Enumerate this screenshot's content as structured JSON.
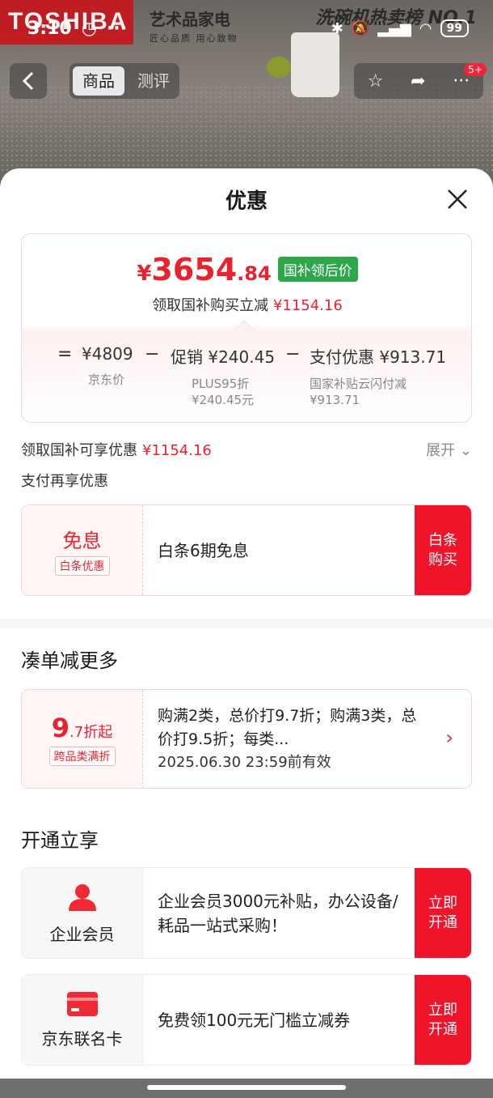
{
  "status_bar": {
    "time": "3:10",
    "battery": "99"
  },
  "banner": {
    "brand": "TOSHIBA",
    "slogan": "艺术品家电",
    "slogan_sub": "匠心品质 用心致物",
    "rank": "洗碗机热卖榜 NO.1"
  },
  "nav": {
    "back_icon": "chevron-left-icon",
    "tabs": [
      "商品",
      "测评"
    ],
    "badge": "5+"
  },
  "sheet": {
    "title": "优惠",
    "close_icon": "close-icon"
  },
  "price_card": {
    "yen": "¥",
    "price_int": "3654",
    "price_dec": ".84",
    "tag": "国补领后价",
    "sub_text": "领取国补购买立减",
    "sub_amount": "¥1154.16",
    "breakdown": [
      {
        "op": "=",
        "main": "¥4809",
        "subs": [
          "京东价"
        ]
      },
      {
        "op": "−",
        "main": "促销 ¥240.45",
        "subs": [
          "PLUS95折",
          "¥240.45元"
        ]
      },
      {
        "op": "−",
        "main": "支付优惠 ¥913.71",
        "subs": [
          "国家补贴云闪付减",
          "¥913.71"
        ]
      }
    ]
  },
  "summary": {
    "label": "领取国补可享优惠",
    "amount": "¥1154.16",
    "expand": "展开",
    "pay_label": "支付再享优惠"
  },
  "baitiao": {
    "left_title": "免息",
    "left_tag": "白条优惠",
    "desc": "白条6期免息",
    "button": "白条\n购买"
  },
  "combo": {
    "section_title": "凑单减更多",
    "discount_big": "9",
    "discount_small": ".7折起",
    "tag": "跨品类满折",
    "desc": "购满2类，总价打9.7折；购满3类，总价打9.5折；每类...",
    "expiry": "2025.06.30 23:59前有效",
    "arrow_icon": "chevron-right-icon"
  },
  "open": {
    "section_title": "开通立享",
    "cards": [
      {
        "icon": "user-icon",
        "label": "企业会员",
        "desc": "企业会员3000元补贴，办公设备/耗品一站式采购！",
        "button": "立即\n开通"
      },
      {
        "icon": "credit-card-icon",
        "label": "京东联名卡",
        "desc": "免费领100元无门槛立减券",
        "button": "立即\n开通"
      }
    ]
  },
  "colors": {
    "accent_red": "#e8222e",
    "button_red": "#f0142a",
    "tag_green": "#2ea64c"
  }
}
